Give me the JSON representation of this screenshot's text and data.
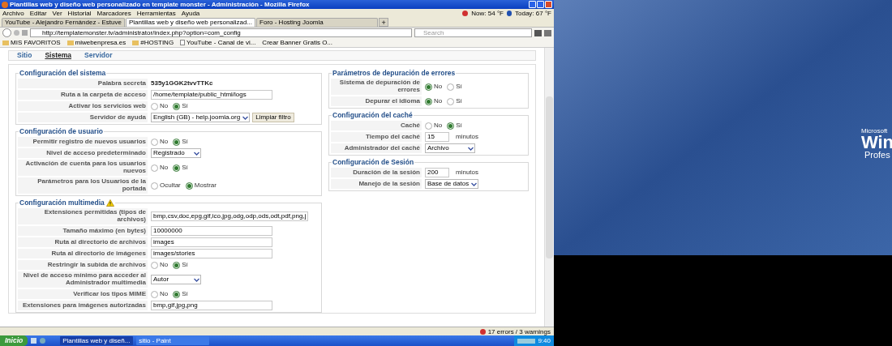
{
  "window": {
    "title": "Plantillas web y diseño web personalizado en template monster - Administración - Mozilla Firefox"
  },
  "menu": [
    "Archivo",
    "Editar",
    "Ver",
    "Historial",
    "Marcadores",
    "Herramientas",
    "Ayuda"
  ],
  "weather": {
    "now": "Now: 54 °F",
    "today": "Today: 67 °F"
  },
  "tabs": [
    {
      "label": "YouTube - Alejandro Fernández - Estuve",
      "selected": false
    },
    {
      "label": "Plantillas web y diseño web personalizad...",
      "selected": true
    },
    {
      "label": "Foro - Hosting Joomla",
      "selected": false
    }
  ],
  "new_tab": "+",
  "address": "http://templatemonster.tv/administrator/index.php?option=com_config",
  "search": {
    "placeholder": "Search"
  },
  "bookmarks": [
    {
      "label": "MIS FAVORITOS",
      "kind": "folder"
    },
    {
      "label": "miwebenpresa.es",
      "kind": "folder"
    },
    {
      "label": "#HOSTING",
      "kind": "folder"
    },
    {
      "label": "YouTube - Canal de vi...",
      "kind": "page"
    },
    {
      "label": "Crear Banner Gratis O...",
      "kind": "text"
    }
  ],
  "config_tabs": [
    {
      "label": "Sitio",
      "selected": false
    },
    {
      "label": "Sistema",
      "selected": true
    },
    {
      "label": "Servidor",
      "selected": false
    }
  ],
  "left_sections": [
    {
      "title": "Configuración del sistema",
      "warning": false,
      "rows": [
        {
          "kind": "static",
          "label": "Palabra secreta",
          "value": "535y1GGK2tvvTTKc"
        },
        {
          "kind": "input",
          "label": "Ruta a la carpeta de acceso",
          "value": "/home/template/public_html/logs"
        },
        {
          "kind": "radio",
          "label": "Activar los servicios web",
          "options": [
            {
              "label": "No",
              "selected": false
            },
            {
              "label": "Sí",
              "selected": true
            }
          ]
        },
        {
          "kind": "select",
          "label": "Servidor de ayuda",
          "value": "English (GB) - help.joomla.org",
          "button": "Limpiar filtro"
        }
      ]
    },
    {
      "title": "Configuración de usuario",
      "warning": false,
      "rows": [
        {
          "kind": "radio",
          "label": "Permitir registro de nuevos usuarios",
          "options": [
            {
              "label": "No",
              "selected": false
            },
            {
              "label": "Sí",
              "selected": true
            }
          ]
        },
        {
          "kind": "select",
          "label": "Nivel de acceso predeterminado",
          "value": "Registrado"
        },
        {
          "kind": "radio",
          "label": "Activación de cuenta para los usuarios nuevos",
          "options": [
            {
              "label": "No",
              "selected": false
            },
            {
              "label": "Sí",
              "selected": true
            }
          ]
        },
        {
          "kind": "radio",
          "label": "Parámetros para los Usuarios de la portada",
          "options": [
            {
              "label": "Ocultar",
              "selected": false
            },
            {
              "label": "Mostrar",
              "selected": true
            }
          ]
        }
      ]
    },
    {
      "title": "Configuración multimedia",
      "warning": true,
      "rows": [
        {
          "kind": "input",
          "label": "Extensiones permitidas (tipos de archivos)",
          "value": "bmp,csv,doc,epg,gif,ico,jpg,odg,odp,ods,odt,pdf,png,j"
        },
        {
          "kind": "input",
          "label": "Tamaño máximo (en bytes)",
          "value": "10000000"
        },
        {
          "kind": "input",
          "label": "Ruta al directorio de archivos",
          "value": "images"
        },
        {
          "kind": "input",
          "label": "Ruta al directorio de imágenes",
          "value": "images/stories"
        },
        {
          "kind": "radio",
          "label": "Restringir la subida de archivos",
          "options": [
            {
              "label": "No",
              "selected": false
            },
            {
              "label": "Sí",
              "selected": true
            }
          ]
        },
        {
          "kind": "select",
          "label": "Nivel de acceso mínimo para acceder al Administrador multimedia",
          "value": "Autor"
        },
        {
          "kind": "radio",
          "label": "Verificar los tipos MIME",
          "options": [
            {
              "label": "No",
              "selected": false
            },
            {
              "label": "Sí",
              "selected": true
            }
          ]
        },
        {
          "kind": "input",
          "label": "Extensiones para imágenes autorizadas",
          "value": "bmp,gif,jpg,png"
        }
      ]
    }
  ],
  "right_sections": [
    {
      "title": "Parámetros de depuración de errores",
      "warning": false,
      "rows": [
        {
          "kind": "radio",
          "label": "Sistema de depuración de errores",
          "options": [
            {
              "label": "No",
              "selected": true
            },
            {
              "label": "Sí",
              "selected": false
            }
          ]
        },
        {
          "kind": "radio",
          "label": "Depurar el idioma",
          "options": [
            {
              "label": "No",
              "selected": true
            },
            {
              "label": "Sí",
              "selected": false
            }
          ]
        }
      ]
    },
    {
      "title": "Configuración del caché",
      "warning": false,
      "rows": [
        {
          "kind": "radio",
          "label": "Caché",
          "options": [
            {
              "label": "No",
              "selected": false
            },
            {
              "label": "Sí",
              "selected": true
            }
          ]
        },
        {
          "kind": "input_unit",
          "label": "Tiempo del caché",
          "value": "15",
          "unit": "minutos"
        },
        {
          "kind": "select",
          "label": "Administrador del caché",
          "value": "Archivo"
        }
      ]
    },
    {
      "title": "Configuración de Sesión",
      "warning": false,
      "rows": [
        {
          "kind": "input_unit",
          "label": "Duración de la sesión",
          "value": "200",
          "unit": "minutos"
        },
        {
          "kind": "select",
          "label": "Manejo de la sesión",
          "value": "Base de datos"
        }
      ]
    }
  ],
  "status_bar": {
    "errors": "17 errors / 3 warnings"
  },
  "taskbar": {
    "start": "Inicio",
    "tasks": [
      {
        "label": "Plantillas web y diseñ...",
        "selected": true
      },
      {
        "label": "sitio - Paint",
        "selected": false
      }
    ],
    "clock": "9:40"
  },
  "desktop": {
    "brand_small": "Microsoft",
    "brand_big": "Win",
    "brand_edition": "Profes"
  }
}
